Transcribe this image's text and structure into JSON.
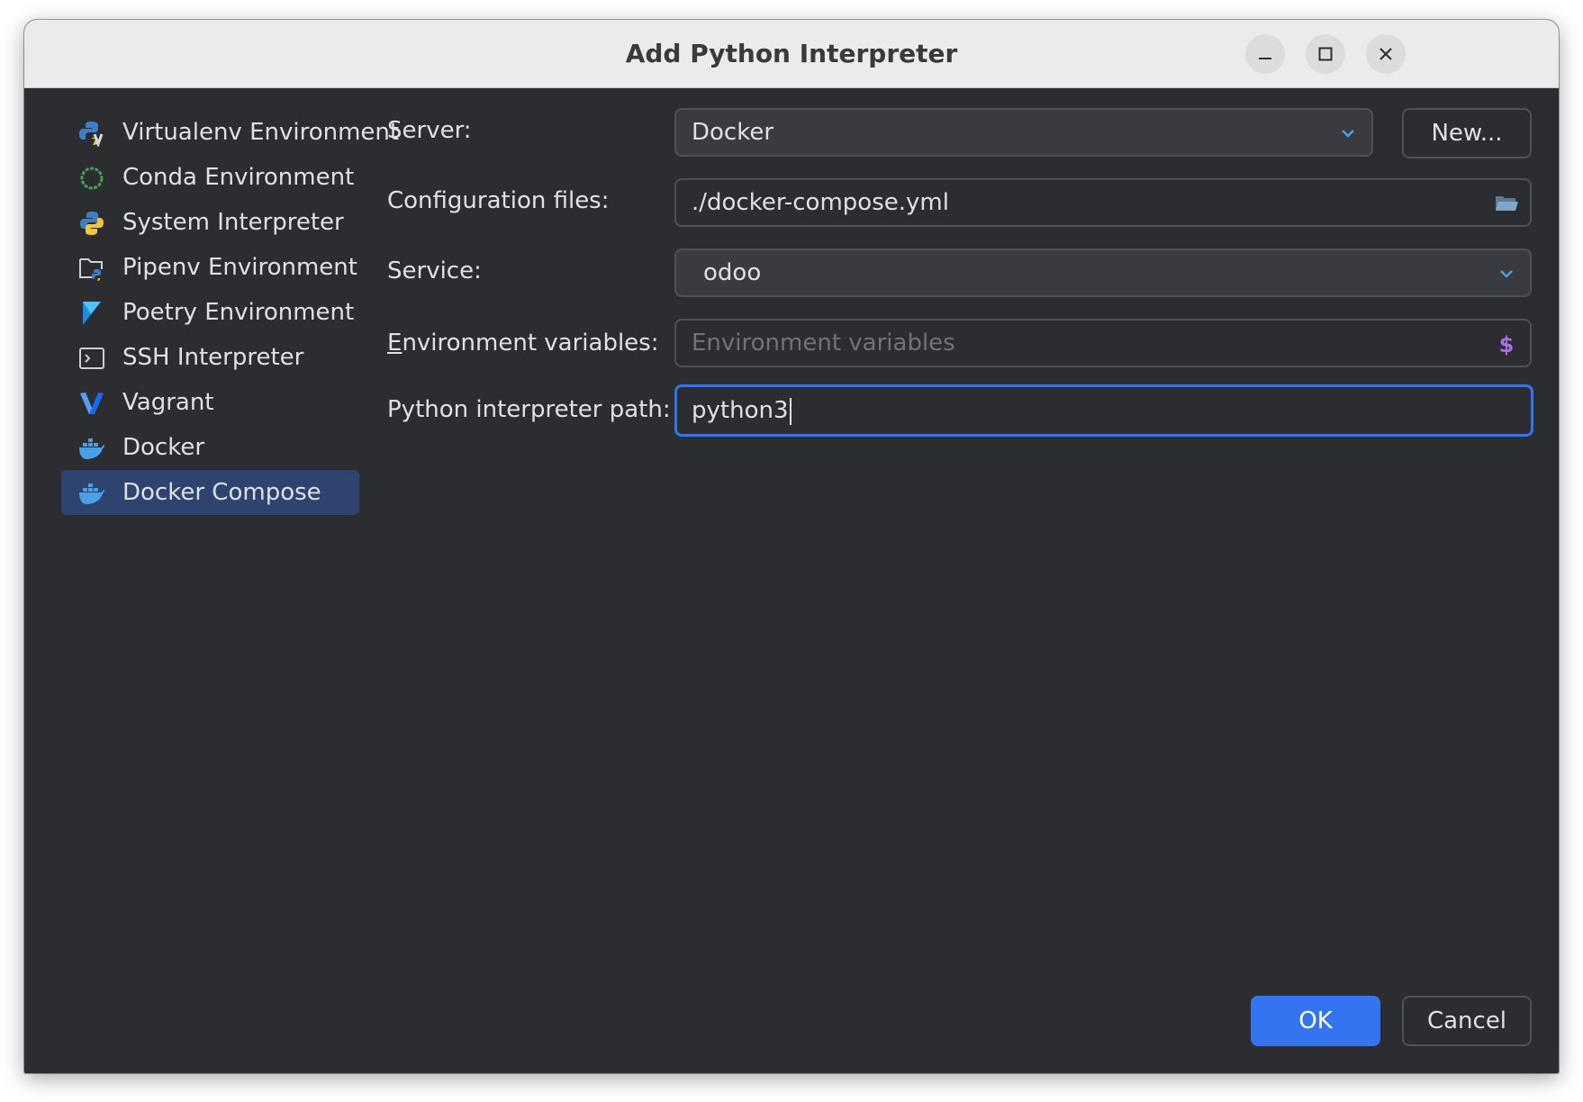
{
  "window": {
    "title": "Add Python Interpreter"
  },
  "sidebar": {
    "items": [
      {
        "label": "Virtualenv Environment",
        "icon": "virtualenv-icon"
      },
      {
        "label": "Conda Environment",
        "icon": "conda-icon"
      },
      {
        "label": "System Interpreter",
        "icon": "python-icon"
      },
      {
        "label": "Pipenv Environment",
        "icon": "pipenv-icon"
      },
      {
        "label": "Poetry Environment",
        "icon": "poetry-icon"
      },
      {
        "label": "SSH Interpreter",
        "icon": "ssh-icon"
      },
      {
        "label": "Vagrant",
        "icon": "vagrant-icon"
      },
      {
        "label": "Docker",
        "icon": "docker-icon"
      },
      {
        "label": "Docker Compose",
        "icon": "docker-compose-icon",
        "selected": true
      }
    ]
  },
  "form": {
    "server": {
      "label": "Server:",
      "value": "Docker"
    },
    "new_button": "New...",
    "config_files": {
      "label": "Configuration files:",
      "value": "./docker-compose.yml"
    },
    "service": {
      "label": "Service:",
      "value": "odoo"
    },
    "env_vars": {
      "label_mnemonic": "E",
      "label_rest": "nvironment variables:",
      "placeholder": "Environment variables"
    },
    "interpreter_path": {
      "label": "Python interpreter path:",
      "value": "python3"
    }
  },
  "footer": {
    "ok": "OK",
    "cancel": "Cancel"
  },
  "colors": {
    "background": "#2b2d30",
    "selection": "#2e436e",
    "accent": "#3574f0",
    "text": "#dfe1e5",
    "placeholder": "#6f737a"
  }
}
